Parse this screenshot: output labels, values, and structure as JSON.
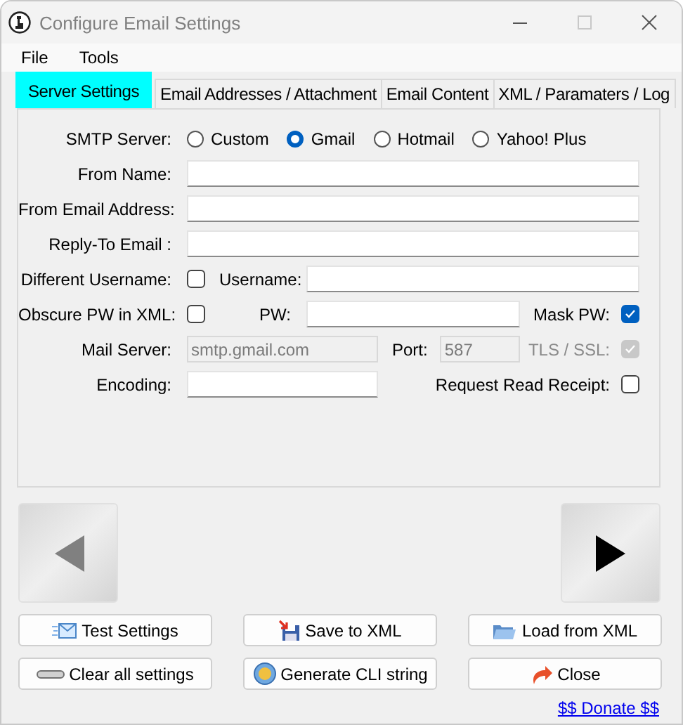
{
  "window": {
    "title": "Configure Email Settings"
  },
  "menu": [
    "File",
    "Tools"
  ],
  "tabs": [
    {
      "label": "Server Settings",
      "selected": true
    },
    {
      "label": "Email Addresses / Attachment",
      "selected": false
    },
    {
      "label": "Email Content",
      "selected": false
    },
    {
      "label": "XML / Paramaters / Log",
      "selected": false
    }
  ],
  "smtp_server": {
    "label": "SMTP Server:",
    "options": [
      {
        "label": "Custom",
        "selected": false
      },
      {
        "label": "Gmail",
        "selected": true
      },
      {
        "label": "Hotmail",
        "selected": false
      },
      {
        "label": "Yahoo! Plus",
        "selected": false
      }
    ]
  },
  "from_name": {
    "label": "From Name:"
  },
  "from_email": {
    "label": "From Email Address:"
  },
  "reply_to": {
    "label": "Reply-To Email :"
  },
  "different_username": {
    "label": "Different Username:",
    "checked": false
  },
  "username": {
    "label": "Username:"
  },
  "obscure_pw": {
    "label": "Obscure PW in XML:",
    "checked": false
  },
  "pw": {
    "label": "PW:"
  },
  "mask_pw": {
    "label": "Mask PW:",
    "checked": true,
    "disabled": false
  },
  "mail_server": {
    "label": "Mail Server:",
    "value": "smtp.gmail.com",
    "disabled": true
  },
  "port": {
    "label": "Port:",
    "value": "587",
    "disabled": true
  },
  "tls_ssl": {
    "label": "TLS / SSL:",
    "checked": true,
    "disabled": true
  },
  "encoding": {
    "label": "Encoding:"
  },
  "read_receipt": {
    "label": "Request Read Receipt:",
    "checked": false,
    "disabled": false
  },
  "nav": [
    {
      "kind": "back",
      "disabled": true
    },
    {
      "kind": "forward",
      "disabled": false
    }
  ],
  "buttons": [
    {
      "kind": "mail",
      "label": "Test Settings"
    },
    {
      "kind": "save",
      "label": "Save to XML"
    },
    {
      "kind": "open",
      "label": "Load from XML"
    },
    {
      "kind": "erase",
      "label": "Clear all settings"
    },
    {
      "kind": "yes",
      "label": "Generate CLI string"
    },
    {
      "kind": "close",
      "label": "Close"
    }
  ],
  "donate_link": "$$ Donate $$"
}
